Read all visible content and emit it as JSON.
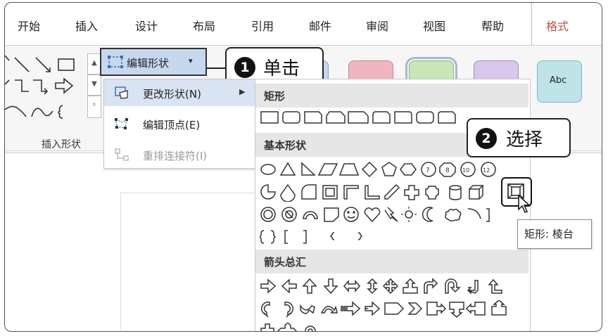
{
  "tabs": [
    {
      "label": "开始"
    },
    {
      "label": "插入"
    },
    {
      "label": "设计"
    },
    {
      "label": "布局"
    },
    {
      "label": "引用"
    },
    {
      "label": "邮件"
    },
    {
      "label": "审阅"
    },
    {
      "label": "视图"
    },
    {
      "label": "帮助"
    },
    {
      "label": "格式"
    }
  ],
  "active_tab": "格式",
  "ribbon": {
    "edit_shape_label": "编辑形状",
    "group_label": "插入形状",
    "style_sample_text": "Abc"
  },
  "callouts": {
    "step1": {
      "number": "1",
      "text": "单击"
    },
    "step2": {
      "number": "2",
      "text": "选择"
    }
  },
  "edit_menu": {
    "items": [
      {
        "label": "更改形状(N)",
        "enabled": true,
        "has_submenu": true
      },
      {
        "label": "编辑顶点(E)",
        "enabled": true,
        "has_submenu": false
      },
      {
        "label": "重排连接符(I)",
        "enabled": false,
        "has_submenu": false
      }
    ]
  },
  "shape_panel": {
    "sections": [
      {
        "title": "矩形"
      },
      {
        "title": "基本形状"
      },
      {
        "title": "箭头总汇"
      }
    ],
    "selected_shape": "棱台",
    "tooltip": "矩形: 棱台"
  },
  "colors": {
    "accent_tab": "#c4503b",
    "button_highlight": "#c5d8ee",
    "style_pink": "#f0b6bf",
    "style_green": "#c9e6b4",
    "style_purple": "#d9c6ec",
    "style_teal": "#bfe4e8"
  }
}
